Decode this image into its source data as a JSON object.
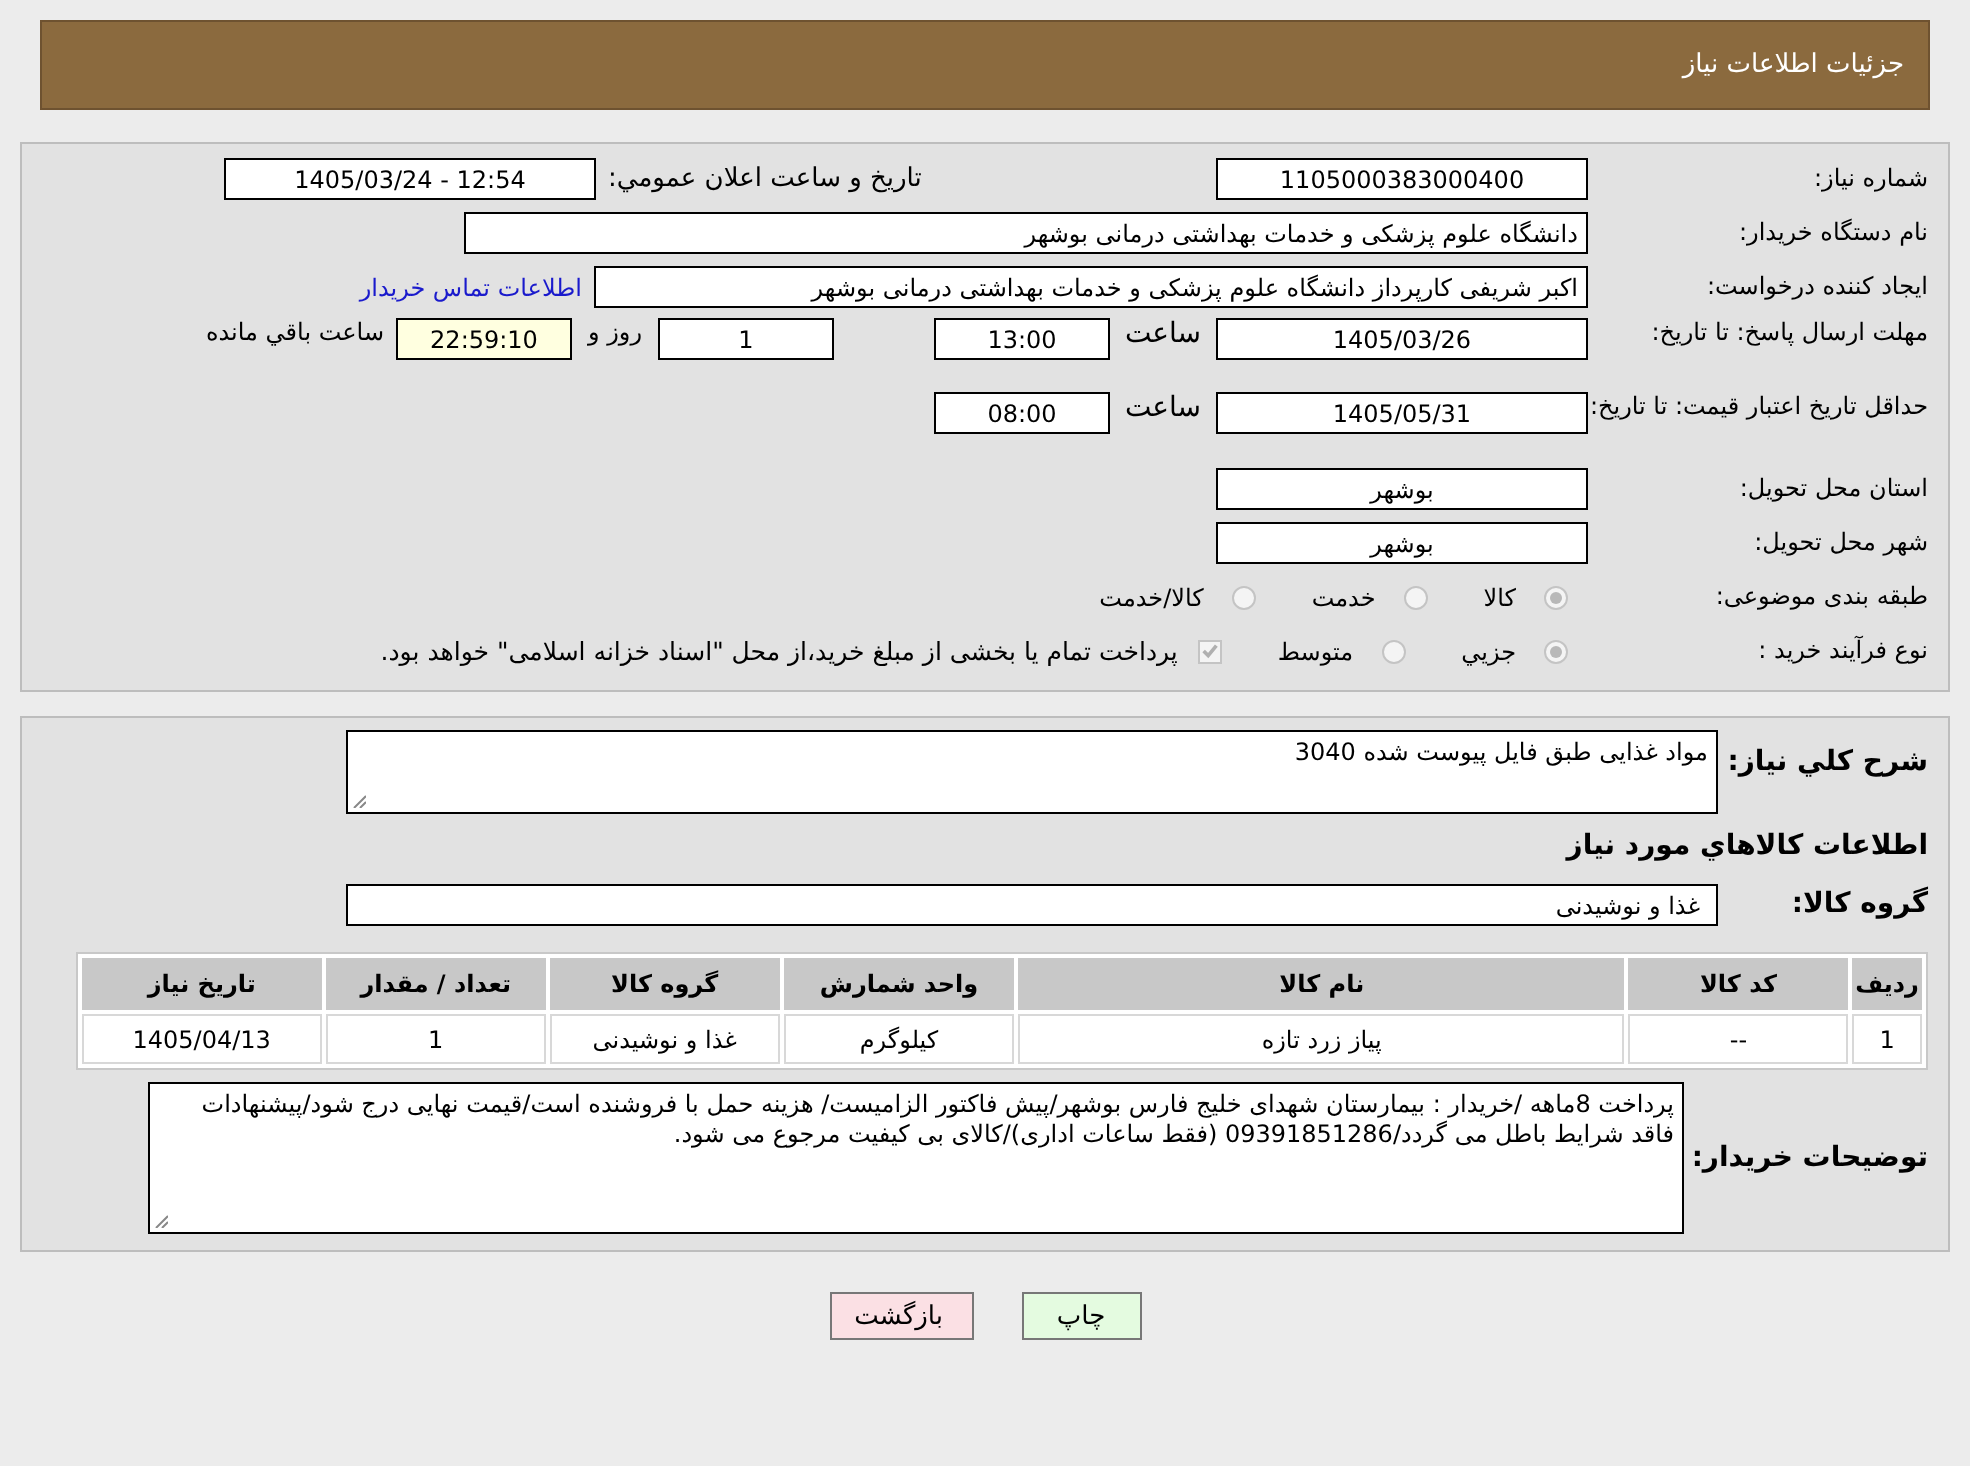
{
  "header": {
    "title": "جزئیات اطلاعات نیاز"
  },
  "details": {
    "need_number": {
      "label": "شماره نیاز:",
      "value": "1105000383000400"
    },
    "announce": {
      "label": "تاریخ و ساعت اعلان عمومي:",
      "value": "1405/03/24 - 12:54"
    },
    "buyer": {
      "label": "نام دستگاه خریدار:",
      "value": "دانشگاه علوم پزشکی و خدمات بهداشتی درمانی بوشهر"
    },
    "creator": {
      "label": "ایجاد کننده درخواست:",
      "value": "اکبر شریفی کارپرداز دانشگاه علوم پزشکی و خدمات بهداشتی درمانی بوشهر",
      "link": "اطلاعات تماس خریدار"
    },
    "deadline": {
      "label": "مهلت ارسال پاسخ: تا تاریخ:",
      "date": "1405/03/26",
      "time_label": "ساعت",
      "time": "13:00",
      "days": "1",
      "days_label": "روز و",
      "remaining": "22:59:10",
      "remaining_label": "ساعت باقي مانده"
    },
    "validity": {
      "label": "حداقل تاریخ اعتبار قیمت: تا تاریخ:",
      "date": "1405/05/31",
      "time_label": "ساعت",
      "time": "08:00"
    },
    "province": {
      "label": "استان محل تحویل:",
      "value": "بوشهر"
    },
    "city": {
      "label": "شهر محل تحویل:",
      "value": "بوشهر"
    },
    "category": {
      "label": "طبقه بندی موضوعی:",
      "options": [
        {
          "label": "کالا",
          "selected": true
        },
        {
          "label": "خدمت",
          "selected": false
        },
        {
          "label": "کالا/خدمت",
          "selected": false
        }
      ]
    },
    "process": {
      "label": "نوع فرآیند خرید :",
      "options": [
        {
          "label": "جزیي",
          "selected": true
        },
        {
          "label": "متوسط",
          "selected": false
        }
      ],
      "treasury": {
        "checked": true,
        "text": "پرداخت تمام یا بخشی از مبلغ خرید،از محل \"اسناد خزانه اسلامی\" خواهد بود."
      }
    }
  },
  "goods": {
    "description": {
      "label": "شرح کلي نیاز:",
      "value": "مواد غذایی طبق فایل پیوست شده 3040"
    },
    "heading": "اطلاعات کالاهاي مورد نیاز",
    "group": {
      "label": "گروه کالا:",
      "value": "غذا و نوشیدنی"
    },
    "table": {
      "columns": [
        "ردیف",
        "کد کالا",
        "نام کالا",
        "واحد شمارش",
        "گروه کالا",
        "تعداد / مقدار",
        "تاریخ نیاز"
      ],
      "rows": [
        [
          "1",
          "--",
          "پیاز زرد تازه",
          "کیلوگرم",
          "غذا و نوشیدنی",
          "1",
          "1405/04/13"
        ]
      ]
    },
    "notes": {
      "label": "توضیحات خریدار:",
      "value": "پرداخت 8ماهه /خریدار : بیمارستان شهدای خلیج فارس بوشهر/پیش فاکتور الزامیست/ هزینه حمل با فروشنده است/قیمت نهایی درج شود/پیشنهادات فاقد شرایط باطل می گردد/09391851286 (فقط ساعات اداری)/کالای بی کیفیت مرجوع می شود."
    }
  },
  "buttons": [
    {
      "kind": "print",
      "label": "چاپ"
    },
    {
      "kind": "back",
      "label": "بازگشت"
    }
  ]
}
